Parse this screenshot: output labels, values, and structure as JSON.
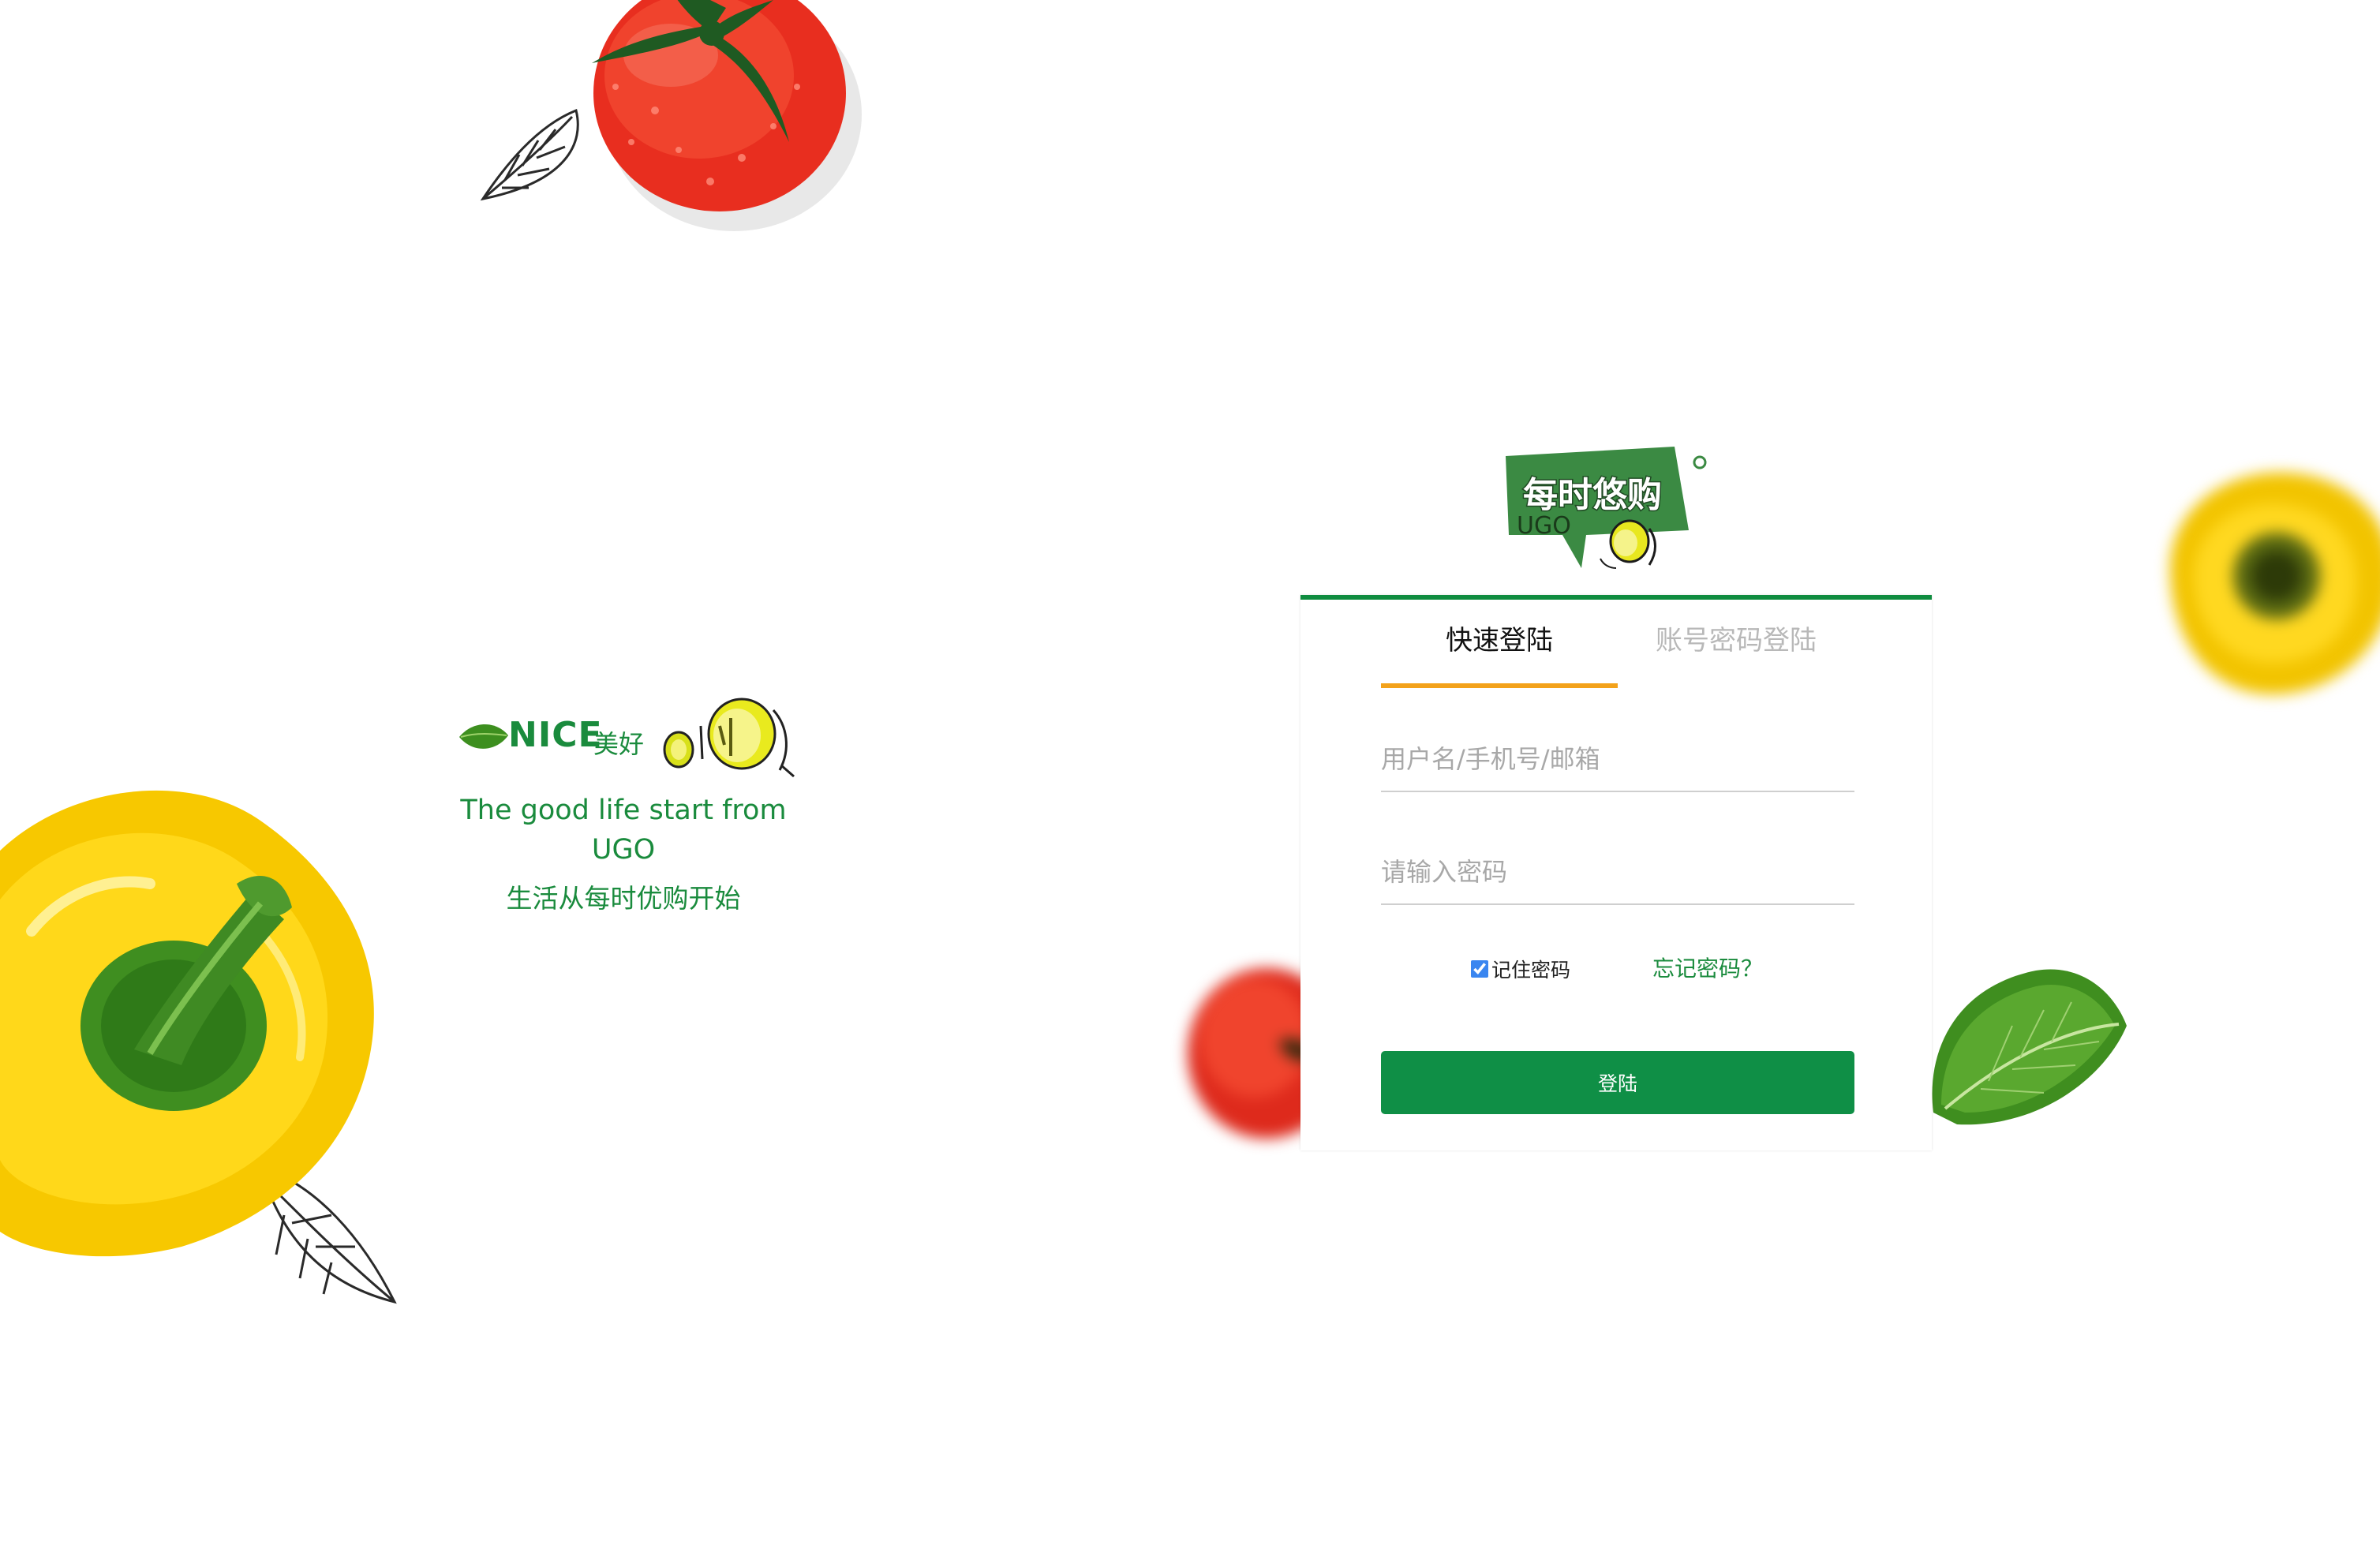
{
  "brand": {
    "logo_text": "每时悠购",
    "logo_subtext": "UGO",
    "accent_green": "#0f8f46",
    "tab_underline_orange": "#f3a21b"
  },
  "slogan": {
    "nice": "NICE",
    "nice_cn": "美好",
    "english": "The good life start from UGO",
    "chinese": "生活从每时优购开始"
  },
  "login": {
    "tabs": [
      {
        "label": "快速登陆",
        "active": true
      },
      {
        "label": "账号密码登陆",
        "active": false
      }
    ],
    "username_placeholder": "用户名/手机号/邮箱",
    "password_placeholder": "请输入密码",
    "remember_label": "记住密码",
    "remember_checked": true,
    "forgot_label": "忘记密码？",
    "submit_label": "登陆"
  },
  "decorations": [
    "tomato-icon",
    "yellow-pepper-icon",
    "leaf-icon"
  ]
}
